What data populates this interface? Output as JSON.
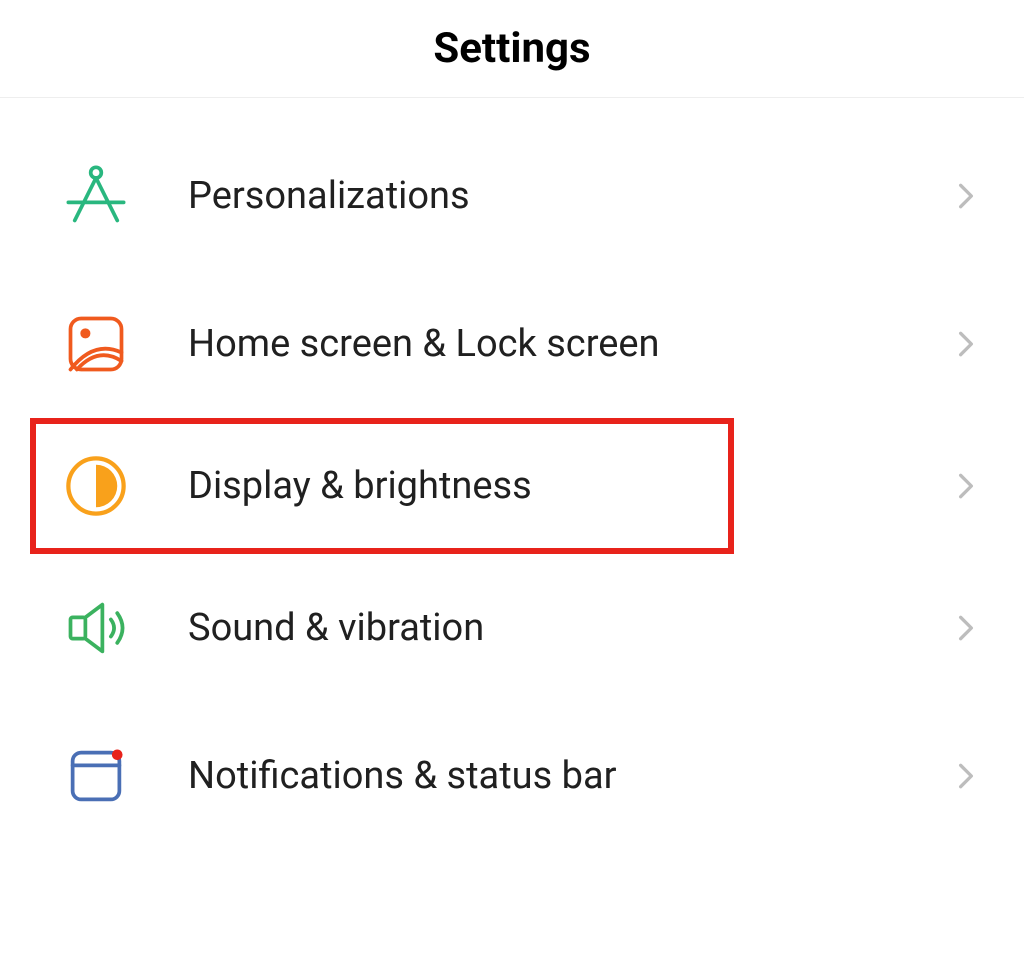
{
  "header": {
    "title": "Settings"
  },
  "items": [
    {
      "label": "Personalizations",
      "icon": "compass-icon",
      "highlighted": false
    },
    {
      "label": "Home screen & Lock screen",
      "icon": "wallpaper-icon",
      "highlighted": false
    },
    {
      "label": "Display & brightness",
      "icon": "brightness-icon",
      "highlighted": true
    },
    {
      "label": "Sound & vibration",
      "icon": "speaker-icon",
      "highlighted": false
    },
    {
      "label": "Notifications & status bar",
      "icon": "notification-panel-icon",
      "highlighted": false
    }
  ],
  "colors": {
    "highlight_border": "#e8231b",
    "icon_green": "#29b77f",
    "icon_orange": "#f05a1e",
    "icon_amber": "#f9a11b",
    "icon_green2": "#3bb25f",
    "icon_blue": "#4a6fb5"
  }
}
